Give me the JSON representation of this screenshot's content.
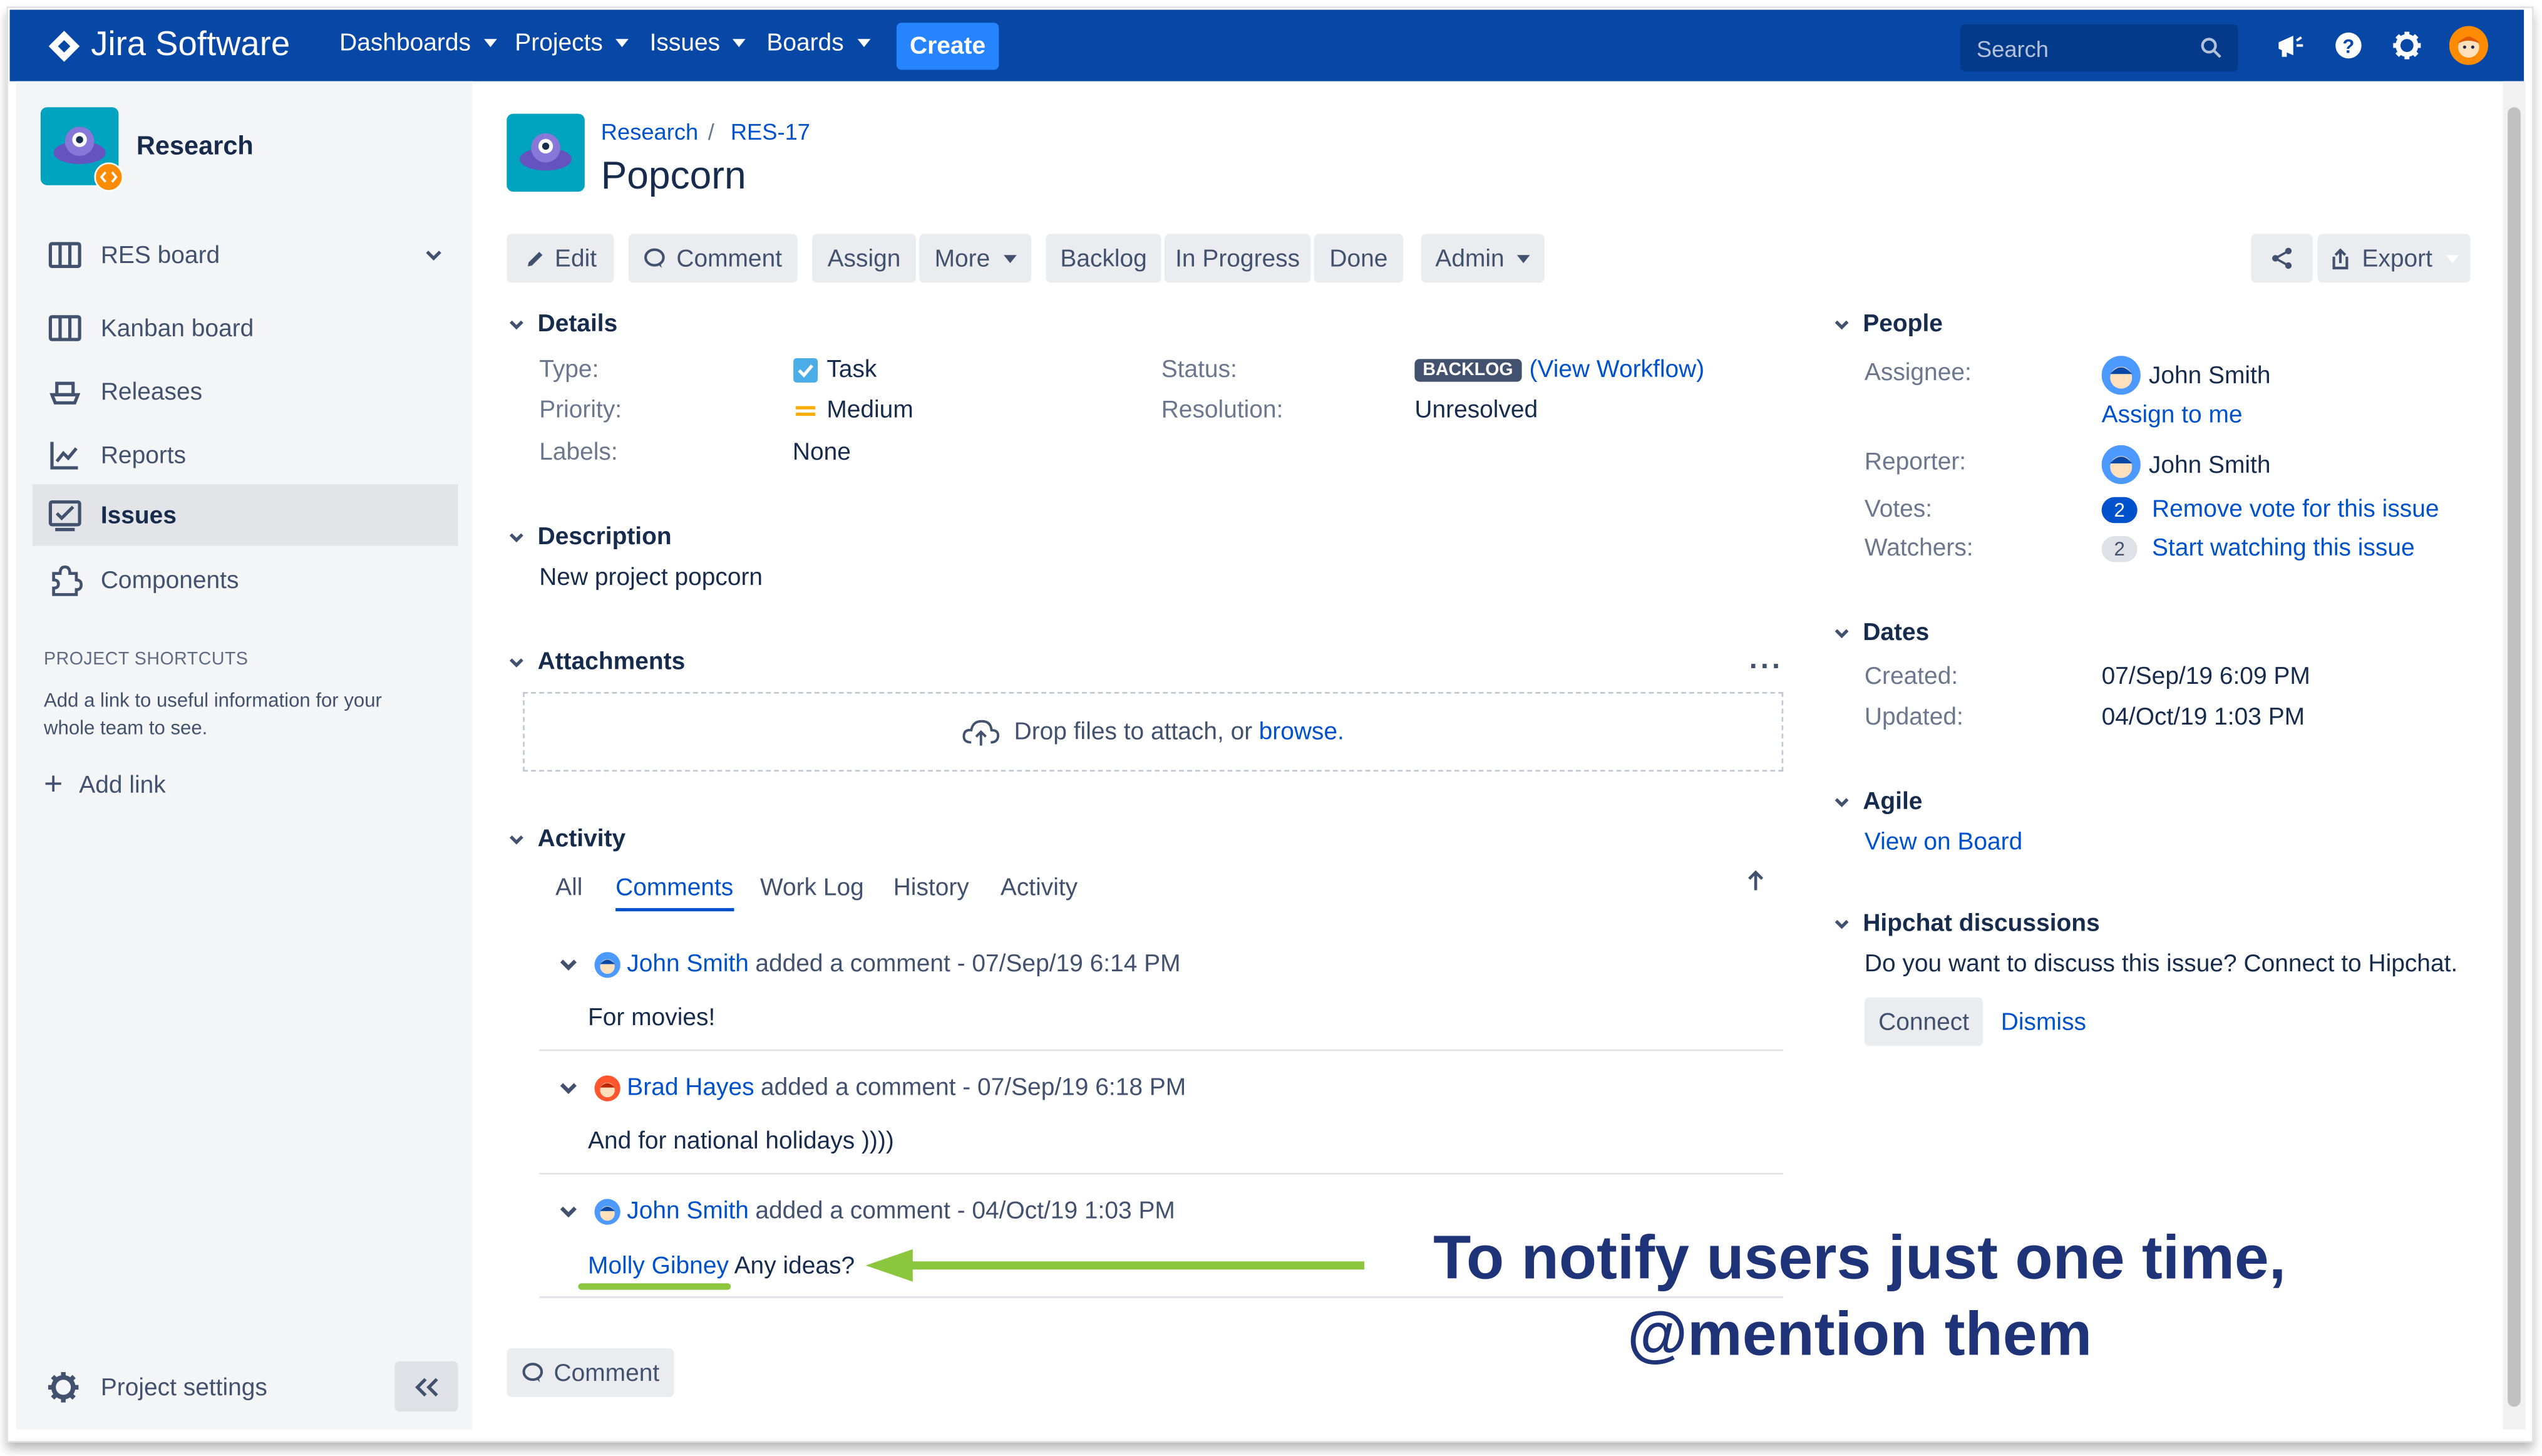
{
  "app": {
    "name": "Jira Software"
  },
  "topnav": {
    "items": [
      "Dashboards",
      "Projects",
      "Issues",
      "Boards"
    ],
    "create_label": "Create",
    "search_placeholder": "Search"
  },
  "sidebar": {
    "project_name": "Research",
    "board_switcher": "RES board",
    "items": [
      {
        "label": "Kanban board",
        "icon": "board-icon"
      },
      {
        "label": "Releases",
        "icon": "ship-icon"
      },
      {
        "label": "Reports",
        "icon": "chart-icon"
      },
      {
        "label": "Issues",
        "icon": "issues-icon",
        "active": true
      },
      {
        "label": "Components",
        "icon": "puzzle-icon"
      }
    ],
    "shortcuts_title": "PROJECT SHORTCUTS",
    "shortcuts_text": "Add a link to useful information for your whole team to see.",
    "add_link": "Add link",
    "project_settings": "Project settings"
  },
  "issue": {
    "breadcrumb_project": "Research",
    "breadcrumb_key": "RES-17",
    "title": "Popcorn"
  },
  "toolbar": {
    "edit": "Edit",
    "comment": "Comment",
    "assign": "Assign",
    "more": "More",
    "backlog": "Backlog",
    "in_progress": "In Progress",
    "done": "Done",
    "admin": "Admin",
    "export": "Export"
  },
  "details": {
    "heading": "Details",
    "type_label": "Type:",
    "type_value": "Task",
    "priority_label": "Priority:",
    "priority_value": "Medium",
    "labels_label": "Labels:",
    "labels_value": "None",
    "status_label": "Status:",
    "status_value": "BACKLOG",
    "view_workflow": "(View Workflow)",
    "resolution_label": "Resolution:",
    "resolution_value": "Unresolved"
  },
  "description": {
    "heading": "Description",
    "text": "New project popcorn"
  },
  "attachments": {
    "heading": "Attachments",
    "drop_text": "Drop files to attach, or",
    "browse": "browse."
  },
  "activity": {
    "heading": "Activity",
    "tabs": [
      "All",
      "Comments",
      "Work Log",
      "History",
      "Activity"
    ],
    "comments": [
      {
        "author": "John Smith",
        "action": "added a comment - 07/Sep/19 6:14 PM",
        "body": "For movies!"
      },
      {
        "author": "Brad Hayes",
        "action": "added a comment - 07/Sep/19 6:18 PM",
        "body": "And for national holidays ))))"
      },
      {
        "author": "John Smith",
        "action": "added a comment - 04/Oct/19 1:03 PM",
        "mention": "Molly Gibney",
        "body": "Any ideas?"
      }
    ],
    "comment_button": "Comment"
  },
  "people": {
    "heading": "People",
    "assignee_label": "Assignee:",
    "assignee": "John Smith",
    "assign_to_me": "Assign to me",
    "reporter_label": "Reporter:",
    "reporter": "John Smith",
    "votes_label": "Votes:",
    "votes_count": "2",
    "votes_action": "Remove vote for this issue",
    "watchers_label": "Watchers:",
    "watchers_count": "2",
    "watchers_action": "Start watching this issue"
  },
  "dates": {
    "heading": "Dates",
    "created_label": "Created:",
    "created": "07/Sep/19 6:09 PM",
    "updated_label": "Updated:",
    "updated": "04/Oct/19 1:03 PM"
  },
  "agile": {
    "heading": "Agile",
    "link": "View on Board"
  },
  "hipchat": {
    "heading": "Hipchat discussions",
    "text": "Do you want to discuss this issue? Connect to Hipchat.",
    "connect": "Connect",
    "dismiss": "Dismiss"
  },
  "annotation": {
    "line1": "To notify users just one time,",
    "line2": "@mention them",
    "color": "#1f3478",
    "arrow_color": "#8cc63f"
  },
  "colors": {
    "nav_bg": "#0747a6",
    "create_bg": "#2684ff",
    "link": "#0052cc"
  }
}
